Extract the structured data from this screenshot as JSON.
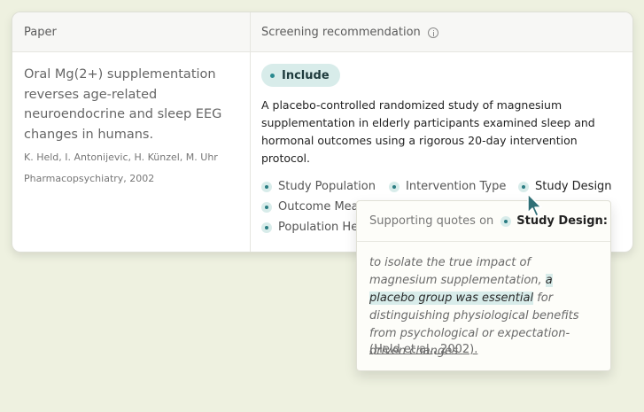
{
  "table": {
    "header": {
      "paper": "Paper",
      "screening": "Screening recommendation"
    },
    "paper": {
      "title": "Oral Mg(2+) supplementation reverses age-related neuroendocrine and sleep EEG changes in humans.",
      "authors": "K. Held, I. Antonijevic, H. Künzel, M. Uhr",
      "journal": "Pharmacopsychiatry, 2002"
    },
    "recommendation": {
      "label": "Include",
      "summary": "A placebo-controlled randomized study of magnesium supplementation in elderly participants examined sleep and hormonal outcomes using a rigorous 20-day intervention protocol."
    },
    "criteria": [
      "Study Population",
      "Intervention Type",
      "Study Design",
      "Outcome Mea",
      "Population He"
    ]
  },
  "popover": {
    "heading": "Supporting quotes on",
    "criterion": "Study Design:",
    "quote_before": "to isolate the true impact of magnesium supplementation, ",
    "quote_highlight": "a placebo group was essential",
    "quote_after": " for distinguishing physiological benefits from psychological or expectation-driven changes",
    "citation": "(Held et al., 2002)."
  },
  "colors": {
    "background": "#eef1e0",
    "accent_bg": "#d8ecea",
    "accent_dot": "#2a7c82",
    "cursor": "#2f6f75"
  },
  "icons": [
    "info-icon",
    "cursor-icon"
  ]
}
